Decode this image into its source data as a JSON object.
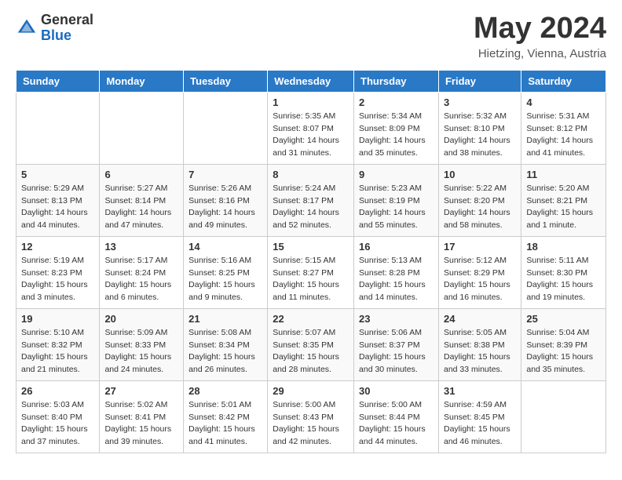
{
  "header": {
    "logo_general": "General",
    "logo_blue": "Blue",
    "month_title": "May 2024",
    "subtitle": "Hietzing, Vienna, Austria"
  },
  "days_of_week": [
    "Sunday",
    "Monday",
    "Tuesday",
    "Wednesday",
    "Thursday",
    "Friday",
    "Saturday"
  ],
  "weeks": [
    [
      {
        "day": "",
        "info": ""
      },
      {
        "day": "",
        "info": ""
      },
      {
        "day": "",
        "info": ""
      },
      {
        "day": "1",
        "info": "Sunrise: 5:35 AM\nSunset: 8:07 PM\nDaylight: 14 hours\nand 31 minutes."
      },
      {
        "day": "2",
        "info": "Sunrise: 5:34 AM\nSunset: 8:09 PM\nDaylight: 14 hours\nand 35 minutes."
      },
      {
        "day": "3",
        "info": "Sunrise: 5:32 AM\nSunset: 8:10 PM\nDaylight: 14 hours\nand 38 minutes."
      },
      {
        "day": "4",
        "info": "Sunrise: 5:31 AM\nSunset: 8:12 PM\nDaylight: 14 hours\nand 41 minutes."
      }
    ],
    [
      {
        "day": "5",
        "info": "Sunrise: 5:29 AM\nSunset: 8:13 PM\nDaylight: 14 hours\nand 44 minutes."
      },
      {
        "day": "6",
        "info": "Sunrise: 5:27 AM\nSunset: 8:14 PM\nDaylight: 14 hours\nand 47 minutes."
      },
      {
        "day": "7",
        "info": "Sunrise: 5:26 AM\nSunset: 8:16 PM\nDaylight: 14 hours\nand 49 minutes."
      },
      {
        "day": "8",
        "info": "Sunrise: 5:24 AM\nSunset: 8:17 PM\nDaylight: 14 hours\nand 52 minutes."
      },
      {
        "day": "9",
        "info": "Sunrise: 5:23 AM\nSunset: 8:19 PM\nDaylight: 14 hours\nand 55 minutes."
      },
      {
        "day": "10",
        "info": "Sunrise: 5:22 AM\nSunset: 8:20 PM\nDaylight: 14 hours\nand 58 minutes."
      },
      {
        "day": "11",
        "info": "Sunrise: 5:20 AM\nSunset: 8:21 PM\nDaylight: 15 hours\nand 1 minute."
      }
    ],
    [
      {
        "day": "12",
        "info": "Sunrise: 5:19 AM\nSunset: 8:23 PM\nDaylight: 15 hours\nand 3 minutes."
      },
      {
        "day": "13",
        "info": "Sunrise: 5:17 AM\nSunset: 8:24 PM\nDaylight: 15 hours\nand 6 minutes."
      },
      {
        "day": "14",
        "info": "Sunrise: 5:16 AM\nSunset: 8:25 PM\nDaylight: 15 hours\nand 9 minutes."
      },
      {
        "day": "15",
        "info": "Sunrise: 5:15 AM\nSunset: 8:27 PM\nDaylight: 15 hours\nand 11 minutes."
      },
      {
        "day": "16",
        "info": "Sunrise: 5:13 AM\nSunset: 8:28 PM\nDaylight: 15 hours\nand 14 minutes."
      },
      {
        "day": "17",
        "info": "Sunrise: 5:12 AM\nSunset: 8:29 PM\nDaylight: 15 hours\nand 16 minutes."
      },
      {
        "day": "18",
        "info": "Sunrise: 5:11 AM\nSunset: 8:30 PM\nDaylight: 15 hours\nand 19 minutes."
      }
    ],
    [
      {
        "day": "19",
        "info": "Sunrise: 5:10 AM\nSunset: 8:32 PM\nDaylight: 15 hours\nand 21 minutes."
      },
      {
        "day": "20",
        "info": "Sunrise: 5:09 AM\nSunset: 8:33 PM\nDaylight: 15 hours\nand 24 minutes."
      },
      {
        "day": "21",
        "info": "Sunrise: 5:08 AM\nSunset: 8:34 PM\nDaylight: 15 hours\nand 26 minutes."
      },
      {
        "day": "22",
        "info": "Sunrise: 5:07 AM\nSunset: 8:35 PM\nDaylight: 15 hours\nand 28 minutes."
      },
      {
        "day": "23",
        "info": "Sunrise: 5:06 AM\nSunset: 8:37 PM\nDaylight: 15 hours\nand 30 minutes."
      },
      {
        "day": "24",
        "info": "Sunrise: 5:05 AM\nSunset: 8:38 PM\nDaylight: 15 hours\nand 33 minutes."
      },
      {
        "day": "25",
        "info": "Sunrise: 5:04 AM\nSunset: 8:39 PM\nDaylight: 15 hours\nand 35 minutes."
      }
    ],
    [
      {
        "day": "26",
        "info": "Sunrise: 5:03 AM\nSunset: 8:40 PM\nDaylight: 15 hours\nand 37 minutes."
      },
      {
        "day": "27",
        "info": "Sunrise: 5:02 AM\nSunset: 8:41 PM\nDaylight: 15 hours\nand 39 minutes."
      },
      {
        "day": "28",
        "info": "Sunrise: 5:01 AM\nSunset: 8:42 PM\nDaylight: 15 hours\nand 41 minutes."
      },
      {
        "day": "29",
        "info": "Sunrise: 5:00 AM\nSunset: 8:43 PM\nDaylight: 15 hours\nand 42 minutes."
      },
      {
        "day": "30",
        "info": "Sunrise: 5:00 AM\nSunset: 8:44 PM\nDaylight: 15 hours\nand 44 minutes."
      },
      {
        "day": "31",
        "info": "Sunrise: 4:59 AM\nSunset: 8:45 PM\nDaylight: 15 hours\nand 46 minutes."
      },
      {
        "day": "",
        "info": ""
      }
    ]
  ]
}
